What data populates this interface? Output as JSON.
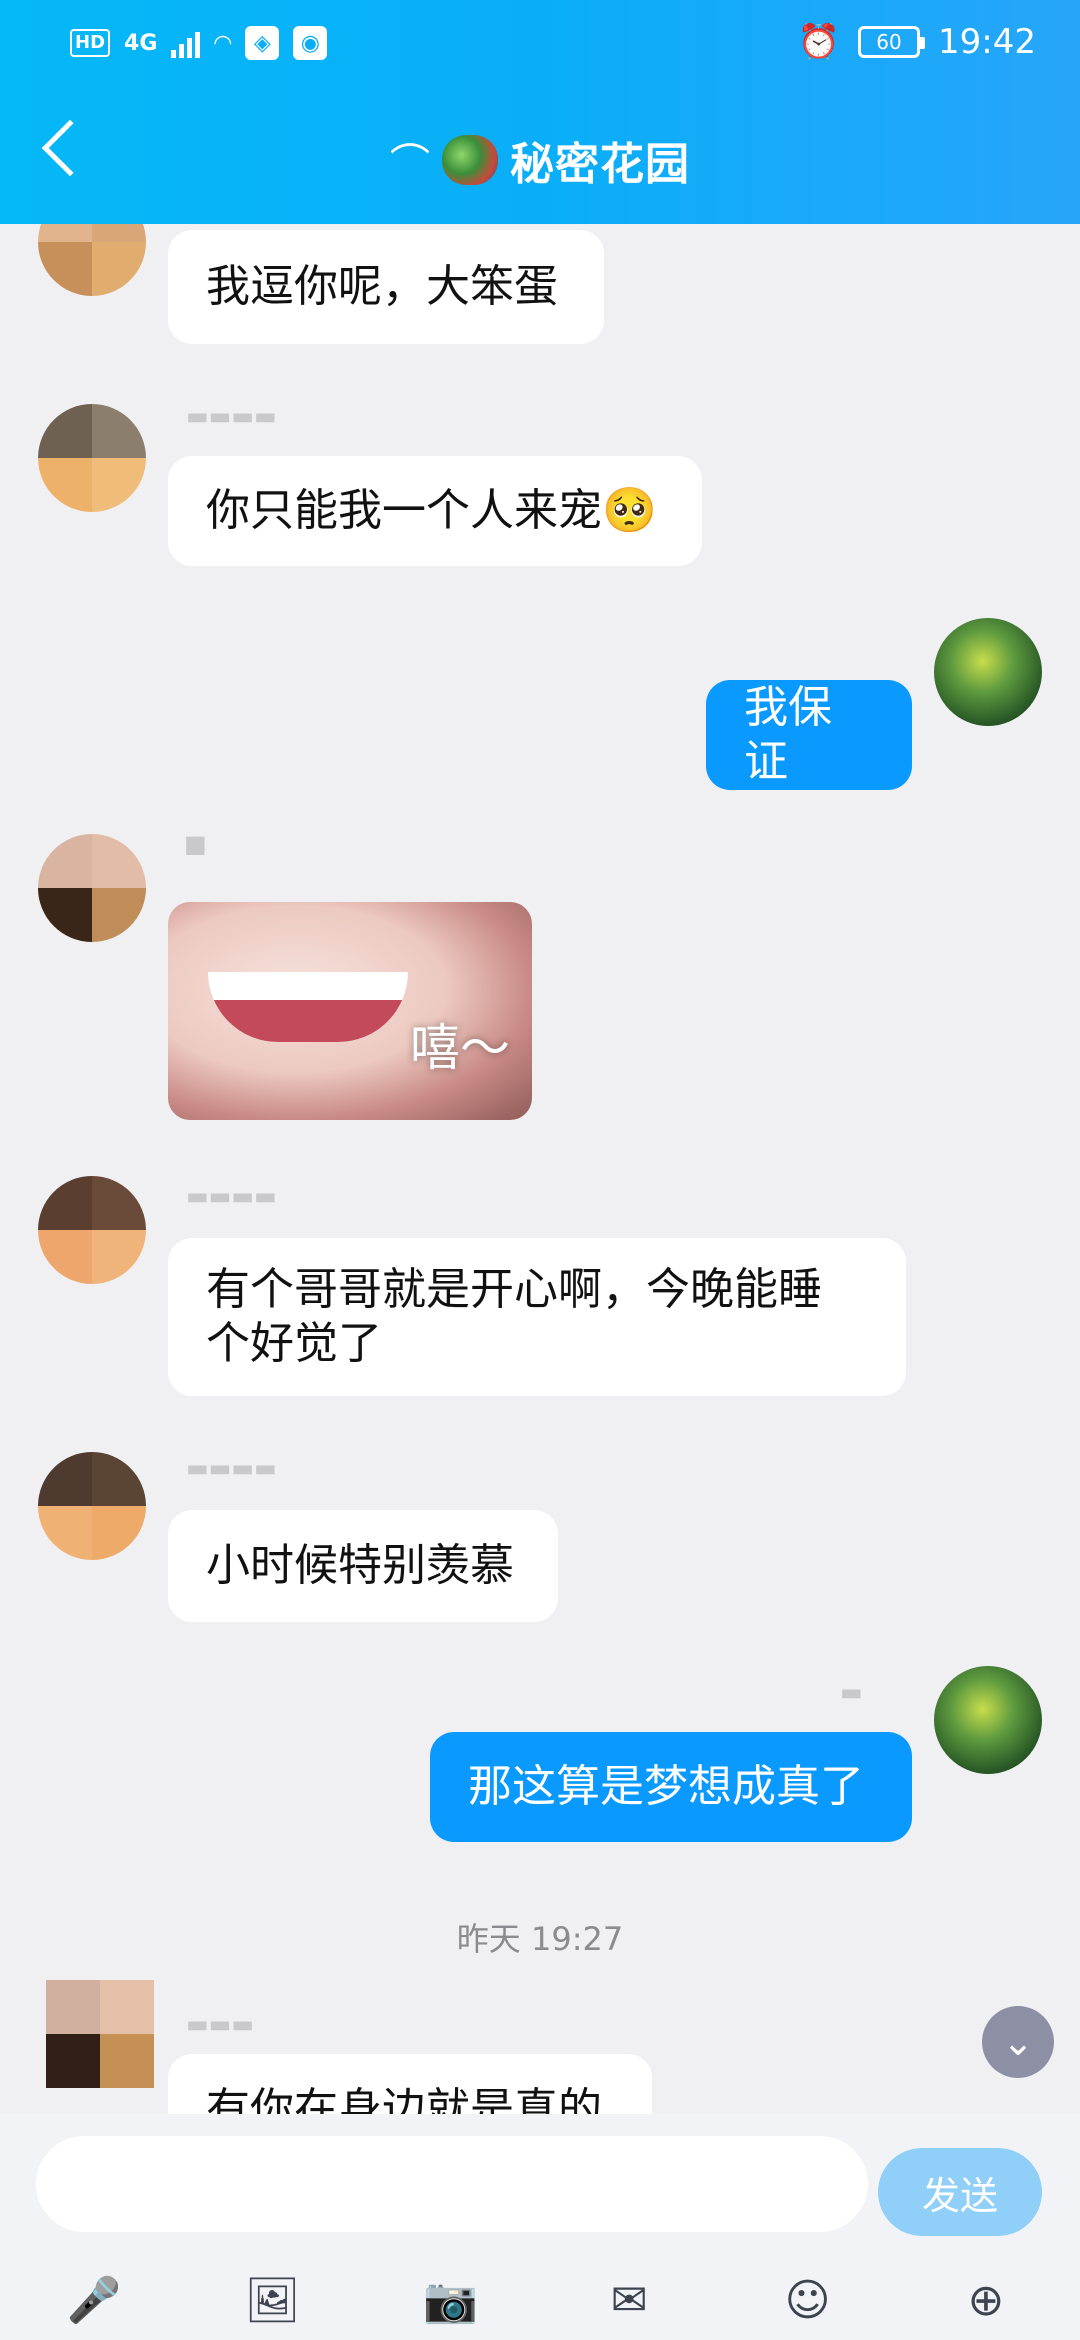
{
  "status_bar": {
    "network": "HD",
    "network2": "4G",
    "battery": "60",
    "time": "19:42"
  },
  "header": {
    "title": "秘密花园"
  },
  "messages": [
    {
      "side": "left",
      "text": "我逗你呢，大笨蛋"
    },
    {
      "side": "left",
      "text": "你只能我一个人来宠🥺"
    },
    {
      "side": "right",
      "text": "我保证"
    },
    {
      "side": "left",
      "image_caption": "嘻～"
    },
    {
      "side": "left",
      "text_line1": "有个哥哥就是开心啊，今晚能睡",
      "text_line2": "个好觉了"
    },
    {
      "side": "left",
      "text": "小时候特别羡慕"
    },
    {
      "side": "right",
      "text": "那这算是梦想成真了"
    },
    {
      "side": "left",
      "text": "有你在身边就是真的"
    }
  ],
  "timestamp": "昨天 19:27",
  "composer": {
    "send_label": "发送"
  }
}
